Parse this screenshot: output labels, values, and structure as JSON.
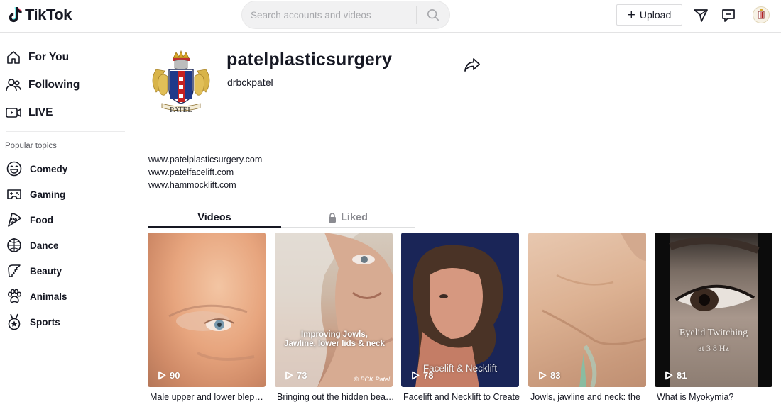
{
  "header": {
    "logo_text": "TikTok",
    "search_placeholder": "Search accounts and videos",
    "upload_label": "Upload",
    "icons": [
      "search-icon",
      "filter-icon",
      "inbox-icon",
      "avatar"
    ]
  },
  "sidebar": {
    "nav": [
      {
        "label": "For You",
        "icon": "home-icon"
      },
      {
        "label": "Following",
        "icon": "following-icon"
      },
      {
        "label": "LIVE",
        "icon": "live-icon"
      }
    ],
    "popular_title": "Popular topics",
    "topics": [
      {
        "label": "Comedy",
        "icon": "comedy-icon"
      },
      {
        "label": "Gaming",
        "icon": "gaming-icon"
      },
      {
        "label": "Food",
        "icon": "food-icon"
      },
      {
        "label": "Dance",
        "icon": "dance-icon"
      },
      {
        "label": "Beauty",
        "icon": "beauty-icon"
      },
      {
        "label": "Animals",
        "icon": "animals-icon"
      },
      {
        "label": "Sports",
        "icon": "sports-icon"
      }
    ]
  },
  "profile": {
    "name": "patelplasticsurgery",
    "handle": "drbckpatel",
    "avatar_text": "PATEL",
    "bio": [
      "www.patelplasticsurgery.com",
      "www.patelfacelift.com",
      "www.hammocklift.com"
    ]
  },
  "tabs": {
    "videos": "Videos",
    "liked": "Liked"
  },
  "videos": [
    {
      "views": "90",
      "caption": "Male upper and lower blepharoplasty",
      "overlay": ""
    },
    {
      "views": "73",
      "caption": "Bringing out the hidden beauty",
      "overlay": "Improving Jowls,\nJawline, lower lids & neck",
      "watermark": "© BCK Patel"
    },
    {
      "views": "78",
      "caption": "Facelift and Necklift to Create",
      "overlay": "Facelift & Necklift"
    },
    {
      "views": "83",
      "caption": "Jowls, jawline and neck: the",
      "overlay": ""
    },
    {
      "views": "81",
      "caption": "What is Myokymia?",
      "overlay": "Eyelid Twitching",
      "overlay2": "at 3 8 Hz"
    }
  ],
  "colors": {
    "text": "#161823",
    "muted": "#8a8b91",
    "border": "#e3e3e4",
    "search_bg": "#f1f1f2"
  }
}
